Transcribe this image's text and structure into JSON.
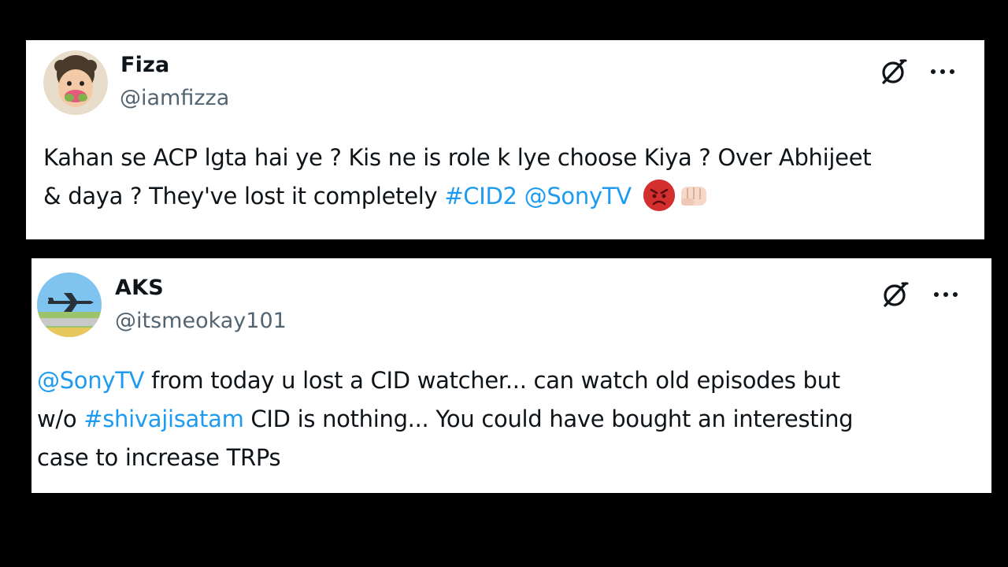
{
  "tweets": [
    {
      "name": "Fiza",
      "handle": "@iamfizza",
      "text_1": "Kahan se ACP lgta hai ye ? Kis ne is role k lye choose Kiya ? Over Abhijeet",
      "text_2": "& daya ? They've lost it completely ",
      "hashtag": "#CID2",
      "mention": "@SonyTV",
      "emojis": [
        "angry-face-emoji",
        "fist-emoji"
      ]
    },
    {
      "name": "AKS",
      "handle": "@itsmeokay101",
      "mention": "@SonyTV",
      "text_1": " from today u lost a CID watcher... can watch old episodes but",
      "text_2a": "w/o ",
      "hashtag": "#shivajisatam",
      "text_2b": " CID is nothing... You could have bought an interesting",
      "text_3": "case to increase TRPs"
    }
  ],
  "icons": {
    "grok": "grok-icon",
    "more": "more-icon"
  },
  "colors": {
    "background": "#000000",
    "card": "#ffffff",
    "text": "#0f1419",
    "secondary": "#536471",
    "link": "#1d9bf0"
  }
}
